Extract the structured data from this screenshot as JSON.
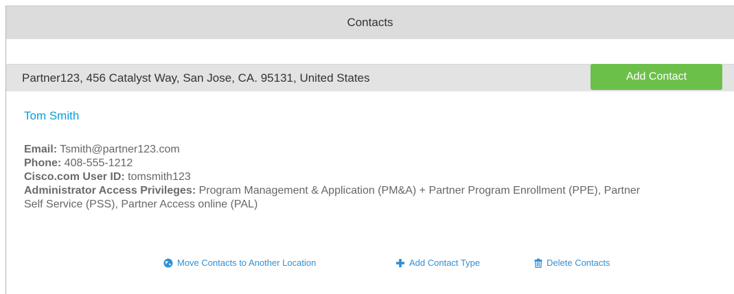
{
  "header": {
    "title": "Contacts"
  },
  "location": {
    "address": "Partner123, 456 Catalyst Way, San Jose, CA. 95131, United States",
    "add_contact_label": "Add Contact"
  },
  "contact": {
    "name": "Tom Smith",
    "fields": {
      "email_label": "Email:",
      "email_value": "Tsmith@partner123.com",
      "phone_label": "Phone:",
      "phone_value": "408-555-1212",
      "userid_label": "Cisco.com User ID:",
      "userid_value": "tomsmith123",
      "privileges_label": "Administrator Access Privileges:",
      "privileges_value": "Program Management & Application (PM&A) + Partner Program Enrollment (PPE), Partner Self Service (PSS), Partner Access online (PAL)"
    }
  },
  "actions": {
    "move_label": "Move Contacts to Another Location",
    "move_icon": "globe-icon",
    "add_type_label": "Add Contact Type",
    "add_type_icon": "plus-icon",
    "delete_label": "Delete Contacts",
    "delete_icon": "trash-icon"
  },
  "colors": {
    "accent_blue": "#049fd9",
    "button_green": "#6cc04a",
    "header_gray": "#dcdcdc"
  }
}
